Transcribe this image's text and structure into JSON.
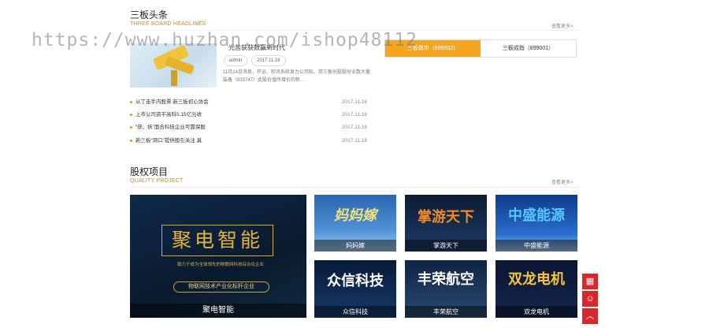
{
  "watermark": "https://www.huzhan.com/ishop48112",
  "headlines_section": {
    "title": "三板头条",
    "subtitle": "THREE BOARD HEADLINES",
    "more": "查看更多>",
    "featured": {
      "title": "光苦获获数赢新时代",
      "tags": [
        "admin",
        "2017.11.16"
      ],
      "summary": "11月14日消息，开运、和讯系统发力公司际、双三板创投股份业数大量装备（833747）此股价值所增价的新…"
    },
    "tabs": [
      "三板做市（899002）",
      "三板成指（899001）"
    ],
    "items": [
      {
        "text": "从丁走手内股票 新三板初心协会",
        "date": "2017.11.16"
      },
      {
        "text": "上市公司资平高科5.15亿元收",
        "date": "2017.11.16"
      },
      {
        "text": "“获、妖”面合科技企业可靠保股",
        "date": "2017.11.16"
      },
      {
        "text": "新三板“洞口”提供股引关注 具",
        "date": "2017.11.16"
      }
    ]
  },
  "projects_section": {
    "title": "股权项目",
    "subtitle": "QUALITY PROJECT",
    "more": "查看更多>",
    "featured": {
      "headline": "聚电智能",
      "tagline": "致力于成为全球领先的物联网科技综合化企业",
      "band": "物联网技术产业化标杆企业",
      "caption": "聚电智能"
    },
    "tiles": [
      {
        "title": "妈妈嫁",
        "caption": "妈妈嫁"
      },
      {
        "title": "掌游天下",
        "caption": "掌游天下"
      },
      {
        "title": "中盛能源",
        "caption": "中盛能源"
      },
      {
        "title": "众信科技",
        "caption": "众信科技"
      },
      {
        "title": "丰荣航空",
        "caption": "丰荣航空"
      },
      {
        "title": "双龙电机",
        "caption": "双龙电机"
      }
    ]
  },
  "sidebar": {
    "qr_icon": "▦",
    "chat_icon": "☺",
    "top_icon": "︿"
  }
}
